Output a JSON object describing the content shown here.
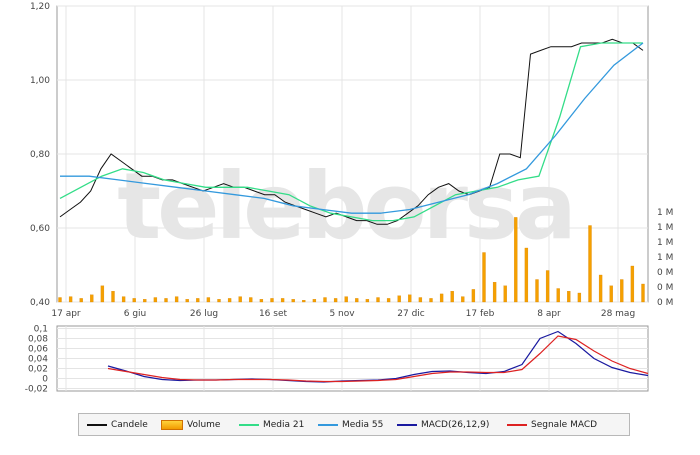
{
  "chart_data": [
    {
      "type": "line",
      "panel": "price",
      "x_categories": [
        "17 apr",
        "6 giu",
        "26 lug",
        "16 set",
        "5 nov",
        "27 dic",
        "17 feb",
        "8 apr",
        "28 mag"
      ],
      "ylim": [
        0.4,
        1.2
      ],
      "y_ticks": [
        "0,40",
        "0,60",
        "0,80",
        "1,00",
        "1,20"
      ],
      "volume_ticks": [
        "0 M",
        "0 M",
        "0 M",
        "1 M",
        "1 M",
        "1 M",
        "1 M"
      ],
      "watermark": "teleborsa",
      "grid": true,
      "series": [
        {
          "name": "Candele",
          "color": "#111111",
          "values": [
            0.63,
            0.65,
            0.67,
            0.7,
            0.76,
            0.8,
            0.78,
            0.76,
            0.74,
            0.74,
            0.73,
            0.73,
            0.72,
            0.71,
            0.7,
            0.71,
            0.72,
            0.71,
            0.71,
            0.7,
            0.69,
            0.69,
            0.67,
            0.66,
            0.65,
            0.64,
            0.63,
            0.64,
            0.63,
            0.62,
            0.62,
            0.61,
            0.61,
            0.62,
            0.64,
            0.66,
            0.69,
            0.71,
            0.72,
            0.7,
            0.69,
            0.7,
            0.71,
            0.8,
            0.8,
            0.79,
            1.07,
            1.08,
            1.09,
            1.09,
            1.09,
            1.1,
            1.1,
            1.1,
            1.11,
            1.1,
            1.1,
            1.08
          ]
        },
        {
          "name": "Media 21",
          "color": "#33dd88",
          "values": [
            0.68,
            0.71,
            0.74,
            0.76,
            0.75,
            0.73,
            0.72,
            0.71,
            0.71,
            0.71,
            0.7,
            0.69,
            0.66,
            0.64,
            0.63,
            0.62,
            0.62,
            0.63,
            0.66,
            0.69,
            0.7,
            0.71,
            0.73,
            0.74,
            0.9,
            1.09,
            1.1,
            1.1,
            1.1
          ]
        },
        {
          "name": "Media 55",
          "color": "#3399dd",
          "values": [
            0.74,
            0.74,
            0.73,
            0.72,
            0.71,
            0.7,
            0.69,
            0.68,
            0.66,
            0.65,
            0.64,
            0.64,
            0.65,
            0.67,
            0.69,
            0.72,
            0.76,
            0.85,
            0.95,
            1.04,
            1.1
          ]
        }
      ],
      "volume": {
        "name": "Volume",
        "color": "#f5a000",
        "values": [
          0.05,
          0.06,
          0.04,
          0.08,
          0.18,
          0.12,
          0.06,
          0.04,
          0.03,
          0.05,
          0.04,
          0.06,
          0.03,
          0.04,
          0.05,
          0.03,
          0.04,
          0.06,
          0.05,
          0.03,
          0.04,
          0.04,
          0.03,
          0.02,
          0.03,
          0.05,
          0.04,
          0.06,
          0.04,
          0.03,
          0.05,
          0.04,
          0.07,
          0.08,
          0.05,
          0.04,
          0.09,
          0.12,
          0.06,
          0.14,
          0.55,
          0.22,
          0.18,
          0.94,
          0.6,
          0.25,
          0.35,
          0.15,
          0.12,
          0.1,
          0.85,
          0.3,
          0.18,
          0.25,
          0.4,
          0.2
        ]
      }
    },
    {
      "type": "line",
      "panel": "macd",
      "ylim": [
        -0.025,
        0.105
      ],
      "y_ticks": [
        "0,1",
        "0,08",
        "0,06",
        "0,04",
        "0,02",
        "0",
        "-0,02"
      ],
      "grid": true,
      "series": [
        {
          "name": "MACD(26,12,9)",
          "color": "#1a1aa0",
          "values": [
            0.025,
            0.015,
            0.004,
            -0.002,
            -0.004,
            -0.003,
            -0.003,
            -0.002,
            -0.001,
            -0.002,
            -0.004,
            -0.006,
            -0.007,
            -0.005,
            -0.004,
            -0.003,
            0.0,
            0.008,
            0.014,
            0.015,
            0.012,
            0.01,
            0.014,
            0.028,
            0.08,
            0.094,
            0.07,
            0.04,
            0.022,
            0.012,
            0.006
          ]
        },
        {
          "name": "Segnale MACD",
          "color": "#dd2222",
          "values": [
            0.02,
            0.014,
            0.008,
            0.002,
            -0.002,
            -0.003,
            -0.003,
            -0.002,
            -0.002,
            -0.002,
            -0.003,
            -0.005,
            -0.006,
            -0.006,
            -0.005,
            -0.004,
            -0.002,
            0.004,
            0.01,
            0.013,
            0.013,
            0.012,
            0.012,
            0.018,
            0.05,
            0.085,
            0.078,
            0.055,
            0.035,
            0.02,
            0.01
          ]
        }
      ]
    }
  ],
  "legend": {
    "items": [
      {
        "label": "Candele",
        "color": "#111111"
      },
      {
        "label": "Volume",
        "color": "#f5a000"
      },
      {
        "label": "Media 21",
        "color": "#33dd88"
      },
      {
        "label": "Media 55",
        "color": "#3399dd"
      },
      {
        "label": "MACD(26,12,9)",
        "color": "#1a1aa0"
      },
      {
        "label": "Segnale MACD",
        "color": "#dd2222"
      }
    ]
  }
}
